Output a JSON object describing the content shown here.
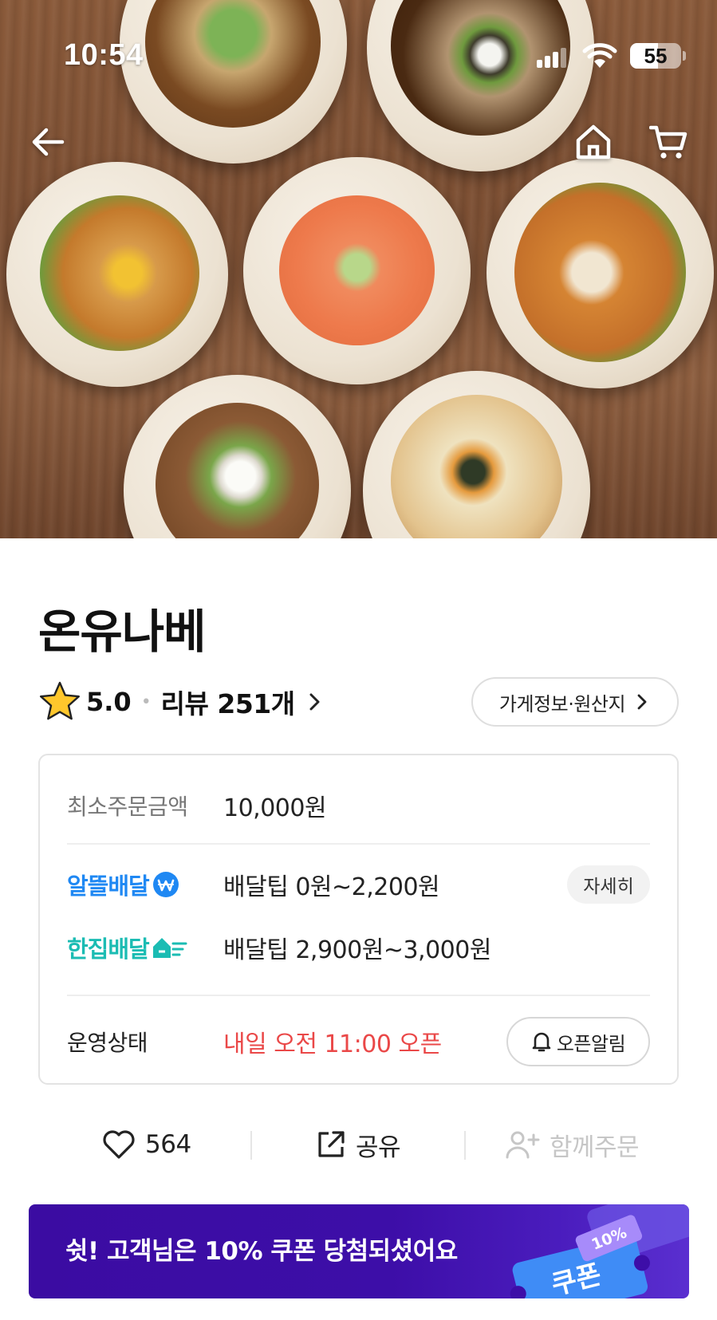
{
  "status_bar": {
    "time": "10:54",
    "battery": "55",
    "battery_level": 0.55
  },
  "hero": {
    "icons": [
      "back-arrow-icon",
      "home-icon",
      "cart-icon"
    ]
  },
  "store": {
    "name": "온유나베",
    "rating": "5.0",
    "review_label": "리뷰 251개",
    "store_info_label": "가게정보·원산지"
  },
  "info": {
    "min_order_label": "최소주문금액",
    "min_order_value": "10,000원",
    "alddeul_brand": "알뜰배달",
    "alddeul_fee": "배달팁 0원~2,200원",
    "detail_label": "자세히",
    "hanjip_brand": "한집배달",
    "hanjip_fee": "배달팁 2,900원~3,000원",
    "status_label": "운영상태",
    "status_value": "내일 오전 11:00 오픈",
    "open_alert_label": "오픈알림"
  },
  "actions": {
    "like_count": "564",
    "share_label": "공유",
    "together_label": "함께주문"
  },
  "coupon": {
    "text": "쉿! 고객님은 10% 쿠폰 당첨되셨어요",
    "ticket_label": "쿠폰",
    "ticket_percent": "10%"
  },
  "colors": {
    "alddeul": "#1f88f3",
    "hanjip": "#1bbcb3",
    "status_red": "#ea4848",
    "coupon_bg": "#3b0ca2"
  }
}
